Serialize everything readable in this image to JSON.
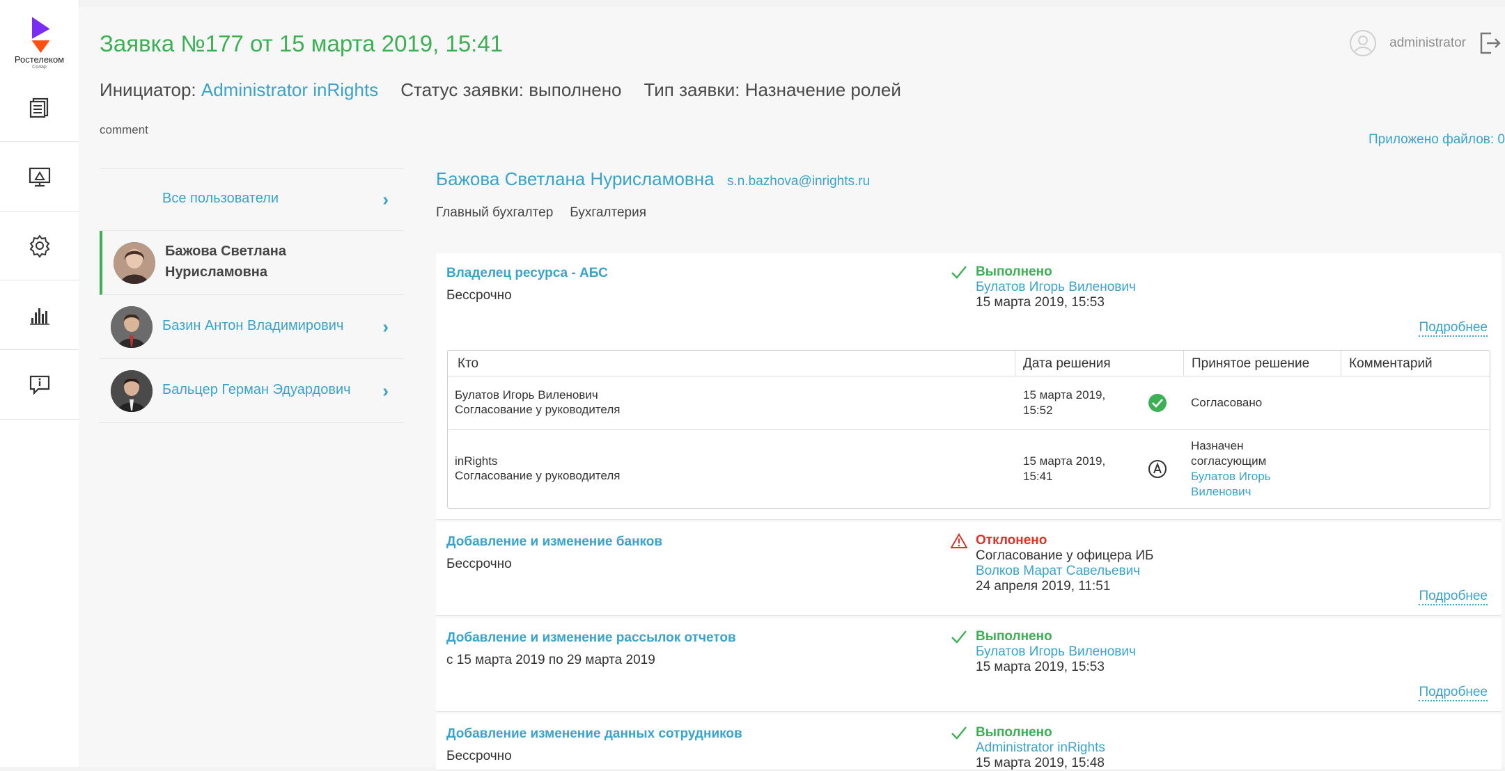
{
  "brand": {
    "name": "Ростелеком",
    "sub": "Солар"
  },
  "sidebar": {
    "items": [
      {
        "icon": "documents-icon"
      },
      {
        "icon": "monitor-icon"
      },
      {
        "icon": "gear-icon"
      },
      {
        "icon": "bar-chart-icon"
      },
      {
        "icon": "feedback-icon"
      }
    ]
  },
  "header": {
    "title": "Заявка №177 от 15 марта 2019, 15:41",
    "user": "administrator",
    "initiator_label": "Инициатор:",
    "initiator_value": "Administrator inRights",
    "status_label": "Статус заявки:",
    "status_value": "выполнено",
    "type_label": "Тип заявки:",
    "type_value": "Назначение ролей",
    "comment": "comment",
    "files": "Приложено файлов: 0"
  },
  "people": {
    "all_label": "Все пользователи",
    "items": [
      {
        "name_line1": "Бажова Светлана",
        "name_line2": "Нурисламовна",
        "active": true
      },
      {
        "name": "Базин Антон Владимирович"
      },
      {
        "name": "Бальцер Герман Эдуардович"
      }
    ]
  },
  "detail": {
    "name": "Бажова Светлана Нурисламовна",
    "email": "s.n.bazhova@inrights.ru",
    "position": "Главный бухгалтер",
    "department": "Бухгалтерия",
    "more_label": "Подробнее",
    "resources": [
      {
        "title": "Владелец ресурса - АБС",
        "period": "Бессрочно",
        "status": "Выполнено",
        "status_kind": "ok",
        "who": "Булатов Игорь Виленович",
        "when": "15 марта 2019, 15:53"
      },
      {
        "title": "Добавление и изменение банков",
        "period": "Бессрочно",
        "status": "Отклонено",
        "status_kind": "err",
        "note": "Согласование у офицера ИБ",
        "who": "Волков Марат Савельевич",
        "when": "24 апреля 2019, 11:51"
      },
      {
        "title": "Добавление и изменение рассылок отчетов",
        "period": "с 15 марта 2019 по 29 марта 2019",
        "status": "Выполнено",
        "status_kind": "ok",
        "who": "Булатов Игорь Виленович",
        "when": "15 марта 2019, 15:53"
      },
      {
        "title": "Добавление изменение данных сотрудников",
        "period": "Бессрочно",
        "status": "Выполнено",
        "status_kind": "ok",
        "who": "Administrator inRights",
        "when": "15 марта 2019, 15:48"
      }
    ],
    "approval_table": {
      "columns": [
        "Кто",
        "Дата решения",
        "Принятое решение",
        "Комментарий"
      ],
      "rows": [
        {
          "who": "Булатов Игорь Виленович",
          "stage": "Согласование у руководителя",
          "date_line1": "15 марта 2019,",
          "date_line2": "15:52",
          "icon": "check-circle-icon",
          "decision": "Согласовано"
        },
        {
          "who": "inRights",
          "stage": "Согласование у руководителя",
          "date_line1": "15 марта 2019,",
          "date_line2": "15:41",
          "icon": "auto-icon",
          "decision_line1": "Назначен",
          "decision_line2": "согласующим",
          "decision_link1": "Булатов Игорь",
          "decision_link2": "Виленович"
        }
      ]
    }
  },
  "colors": {
    "accent": "#3aa3cc",
    "success": "#3cb054",
    "danger": "#d9342b"
  }
}
